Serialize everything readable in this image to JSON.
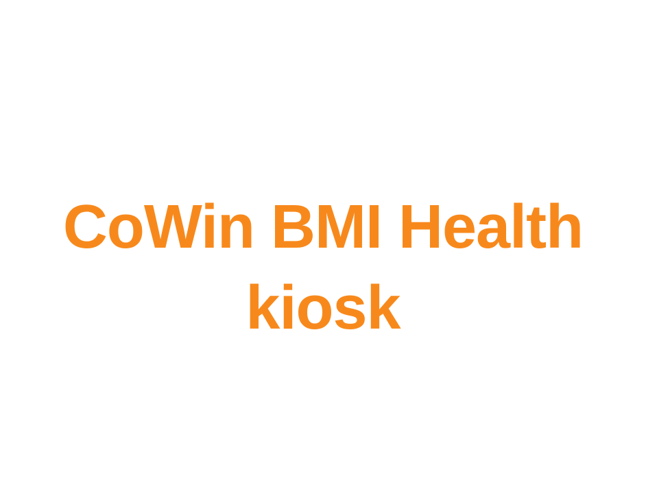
{
  "title": {
    "line1": "CoWin BMI Health",
    "line2": "kiosk"
  },
  "colors": {
    "background": "#ffffff",
    "title_text": "#F7891C"
  }
}
